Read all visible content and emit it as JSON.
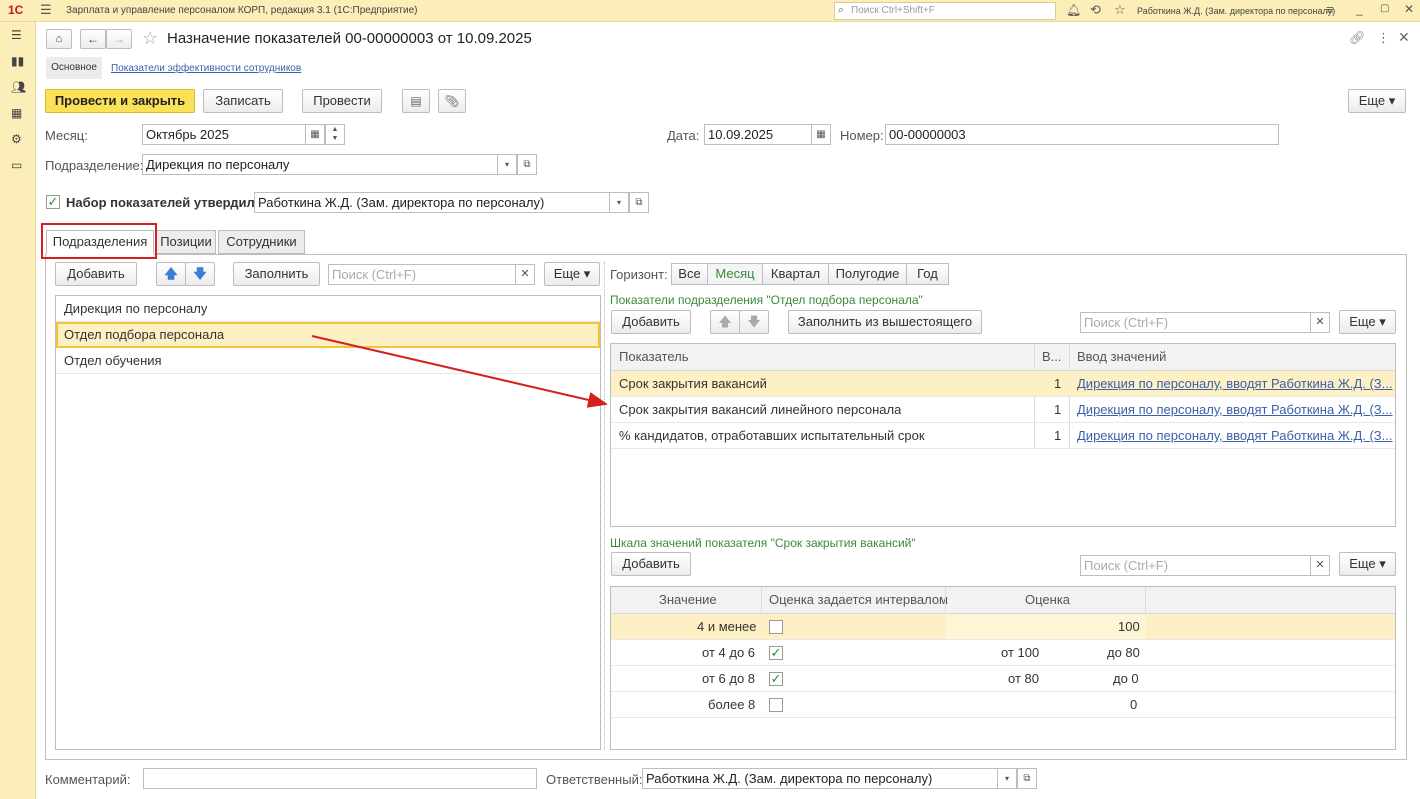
{
  "app": {
    "logo": "1С",
    "title": "Зарплата и управление персоналом КОРП, редакция 3.1  (1С:Предприятие)",
    "search_placeholder": "Поиск Ctrl+Shift+F",
    "user": "Работкина Ж.Д. (Зам. директора по персоналу)"
  },
  "doc": {
    "title": "Назначение показателей 00-00000003 от 10.09.2025",
    "nav_main": "Основное",
    "nav_link": "Показатели эффективности сотрудников"
  },
  "toolbar": {
    "post_close": "Провести и закрыть",
    "save": "Записать",
    "post": "Провести",
    "more": "Еще"
  },
  "fields": {
    "month_label": "Месяц:",
    "month_value": "Октябрь 2025",
    "date_label": "Дата:",
    "date_value": "10.09.2025",
    "number_label": "Номер:",
    "number_value": "00-00000003",
    "dept_label": "Подразделение:",
    "dept_value": "Дирекция по персоналу",
    "approved_label": "Набор показателей утвердил",
    "approved_value": "Работкина Ж.Д. (Зам. директора по персоналу)"
  },
  "tabs": [
    "Подразделения",
    "Позиции",
    "Сотрудники"
  ],
  "left": {
    "add": "Добавить",
    "fill": "Заполнить",
    "search_placeholder": "Поиск (Ctrl+F)",
    "more": "Еще",
    "items": [
      "Дирекция по персоналу",
      "Отдел подбора персонала",
      "Отдел обучения"
    ]
  },
  "horizon": {
    "label": "Горизонт:",
    "options": [
      "Все",
      "Месяц",
      "Квартал",
      "Полугодие",
      "Год"
    ]
  },
  "indicators": {
    "title": "Показатели подразделения \"Отдел подбора персонала\"",
    "add": "Добавить",
    "fill_from_parent": "Заполнить из вышестоящего",
    "search_placeholder": "Поиск (Ctrl+F)",
    "more": "Еще",
    "col_indicator": "Показатель",
    "col_weight": "В...",
    "col_input": "Ввод значений",
    "rows": [
      {
        "name": "Срок закрытия вакансий",
        "weight": "1",
        "input": "Дирекция по персоналу, вводят Работкина Ж.Д. (З..."
      },
      {
        "name": "Срок закрытия вакансий линейного персонала",
        "weight": "1",
        "input": "Дирекция по персоналу, вводят Работкина Ж.Д. (З..."
      },
      {
        "name": "% кандидатов, отработавших испытательный срок",
        "weight": "1",
        "input": "Дирекция по персоналу, вводят Работкина Ж.Д. (З..."
      }
    ]
  },
  "scale": {
    "title": "Шкала значений показателя \"Срок закрытия вакансий\"",
    "add": "Добавить",
    "search_placeholder": "Поиск (Ctrl+F)",
    "more": "Еще",
    "col_value": "Значение",
    "col_interval": "Оценка задается интервалом",
    "col_score": "Оценка",
    "rows": [
      {
        "value": "4 и менее",
        "interval": false,
        "from": "",
        "to": "",
        "score": "100"
      },
      {
        "value": "от 4 до 6",
        "interval": true,
        "from": "от 100",
        "to": "до 80",
        "score": ""
      },
      {
        "value": "от 6 до 8",
        "interval": true,
        "from": "от 80",
        "to": "до 0",
        "score": ""
      },
      {
        "value": "более 8",
        "interval": false,
        "from": "",
        "to": "",
        "score": "0"
      }
    ]
  },
  "footer": {
    "comment_label": "Комментарий:",
    "responsible_label": "Ответственный:",
    "responsible_value": "Работкина Ж.Д. (Зам. директора по персоналу)"
  },
  "colors": {
    "accent_yellow": "#fbe158",
    "highlight_row": "#fdf0c4",
    "annotation_red": "#d42020",
    "link": "#3c5fa8"
  }
}
